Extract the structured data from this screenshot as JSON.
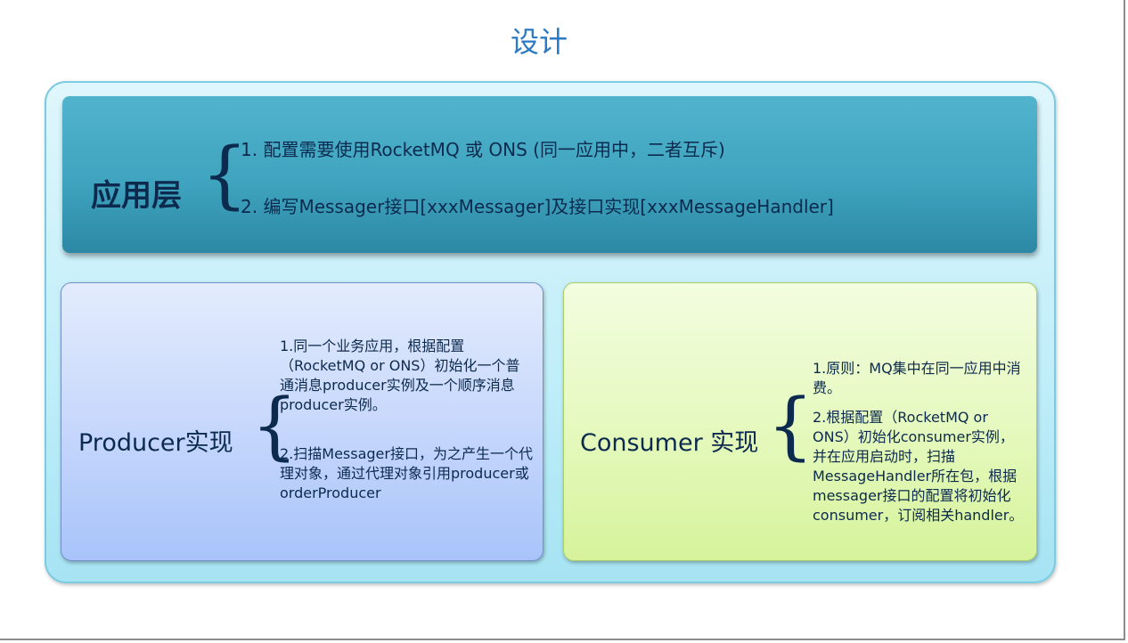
{
  "title": "设计",
  "app_layer": {
    "label": "应用层",
    "items": [
      "1. 配置需要使用RocketMQ 或 ONS (同一应用中，二者互斥)",
      "2. 编写Messager接口[xxxMessager]及接口实现[xxxMessageHandler]"
    ]
  },
  "producer": {
    "label": "Producer实现",
    "items": [
      "1.同一个业务应用，根据配置（RocketMQ or ONS）初始化一个普通消息producer实例及一个顺序消息producer实例。",
      "2.扫描Messager接口，为之产生一个代理对象，通过代理对象引用producer或orderProducer"
    ]
  },
  "consumer": {
    "label": "Consumer 实现",
    "items": [
      "1.原则：MQ集中在同一应用中消费。",
      "2.根据配置（RocketMQ or ONS）初始化consumer实例，并在应用启动时，扫描MessageHandler所在包，根据messager接口的配置将初始化consumer，订阅相关handler。"
    ]
  },
  "colors": {
    "title": "#2a79c4",
    "text": "#0c2a4e",
    "app_layer_bg": "#3fa4bf",
    "producer_bg": "#c8d8fc",
    "consumer_bg": "#e6f9c0",
    "outer_panel_bg": "#bfeef9"
  }
}
